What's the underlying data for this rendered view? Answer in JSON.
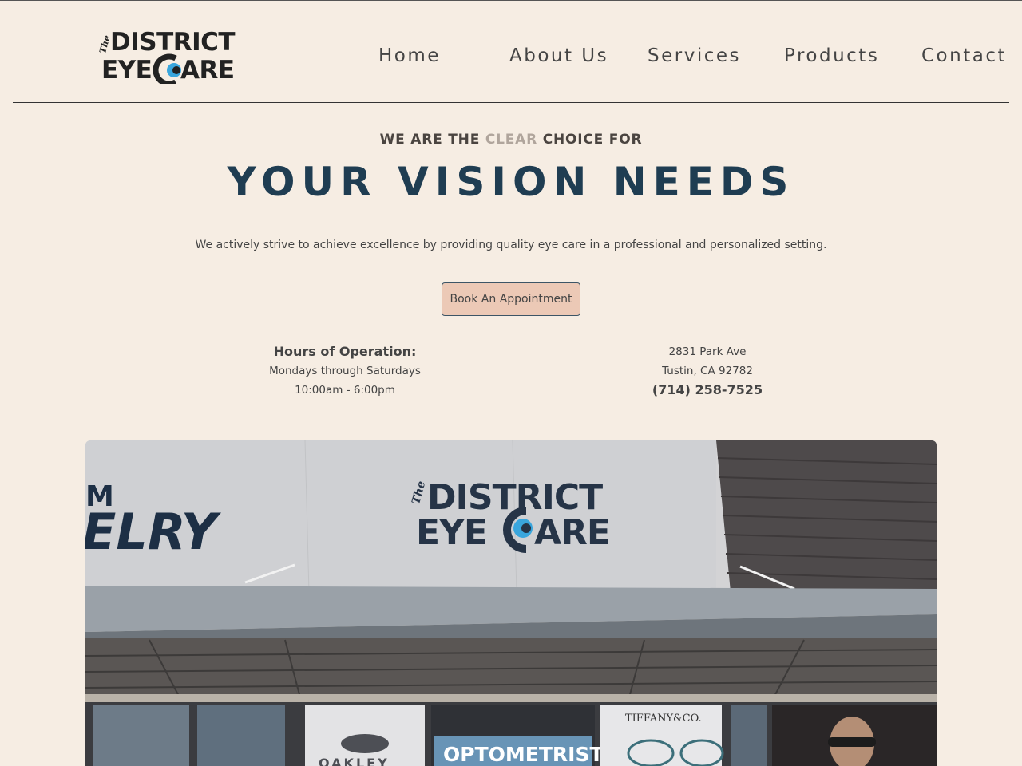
{
  "header": {
    "logo": {
      "the": "The",
      "line1": "DISTRICT",
      "line2a": "EYE",
      "line2b": "ARE"
    },
    "nav": {
      "home": "Home",
      "about": "About Us",
      "services": "Services",
      "products": "Products",
      "contact": "Contact"
    }
  },
  "hero": {
    "tagline_pre": "WE ARE THE ",
    "tagline_clear": "CLEAR",
    "tagline_post": " CHOICE FOR",
    "headline": "YOUR VISION NEEDS",
    "subtext": "We actively strive to achieve excellence by providing quality eye care in a professional and personalized setting.",
    "cta": "Book An Appointment"
  },
  "hours": {
    "title": "Hours of Operation:",
    "days": "Mondays through Saturdays",
    "time": "10:00am - 6:00pm"
  },
  "address": {
    "street": "2831 Park Ave",
    "city": "Tustin, CA 92782",
    "phone": "(714) 258-7525"
  },
  "storefront": {
    "neighbor_sign_top": "M",
    "neighbor_sign": "ELRY",
    "sign_the": "The",
    "sign_line1": "DISTRICT",
    "sign_line2a": "EYE",
    "sign_line2b": "ARE",
    "window_brand1": "OAKLEY",
    "window_optometrist": "OPTOMETRIST",
    "window_brand2": "TIFFANY&CO."
  },
  "colors": {
    "background": "#f6ede3",
    "headline": "#1f3d52",
    "button": "#ecc9b6",
    "logo_accent": "#3aa6dd"
  }
}
